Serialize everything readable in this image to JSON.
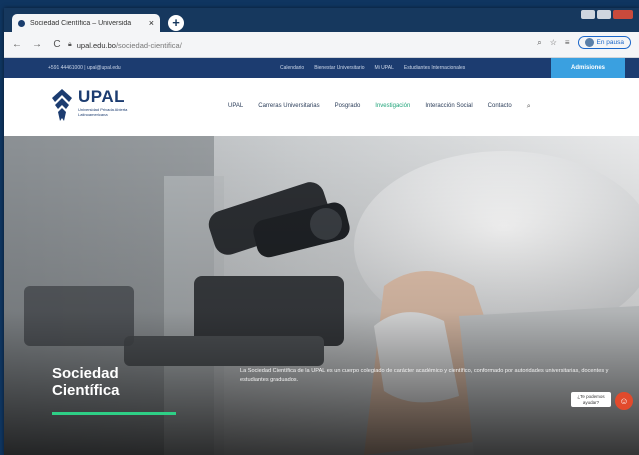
{
  "browser": {
    "tab_title": "Sociedad Científica – Universida",
    "tab_close": "×",
    "new_tab": "+",
    "back": "←",
    "forward": "→",
    "reload": "C",
    "url_domain": "upal.edu.bo",
    "url_path": "/sociedad-cientifica/",
    "profile_label": "En pausa",
    "zoom_icon": "magnifier-icon",
    "star_icon": "star-icon",
    "reading_icon": "reading-list-icon"
  },
  "topbar": {
    "contact": "+591 44461000 | upal@upal.edu",
    "links": [
      "Calendario",
      "Bienestar Universitario",
      "Mi UPAL",
      "Estudiantes Internacionales"
    ],
    "admisiones": "Admisiones"
  },
  "header": {
    "logo_name": "UPAL",
    "logo_sub": "Universidad Privada Abierta Latinoamericana",
    "nav": [
      "UPAL",
      "Carreras Universitarias",
      "Posgrado",
      "Investigación",
      "Interacción Social",
      "Contacto"
    ],
    "nav_active_index": 3,
    "search_icon": "⌕"
  },
  "hero": {
    "title_line1": "Sociedad",
    "title_line2": "Científica",
    "description": "La Sociedad Científica de la UPAL es un cuerpo colegiado de carácter académico y científico, conformado por autoridades universitarias, docentes y estudiantes graduados."
  },
  "chat": {
    "bubble_line1": "¿Te podemos",
    "bubble_line2": "ayudar?",
    "button_icon": "chat-icon"
  },
  "colors": {
    "brand_navy": "#1c3c70",
    "accent_green": "#21a47a",
    "admisiones_blue": "#3aa0e0",
    "chat_red": "#e24a2c"
  }
}
